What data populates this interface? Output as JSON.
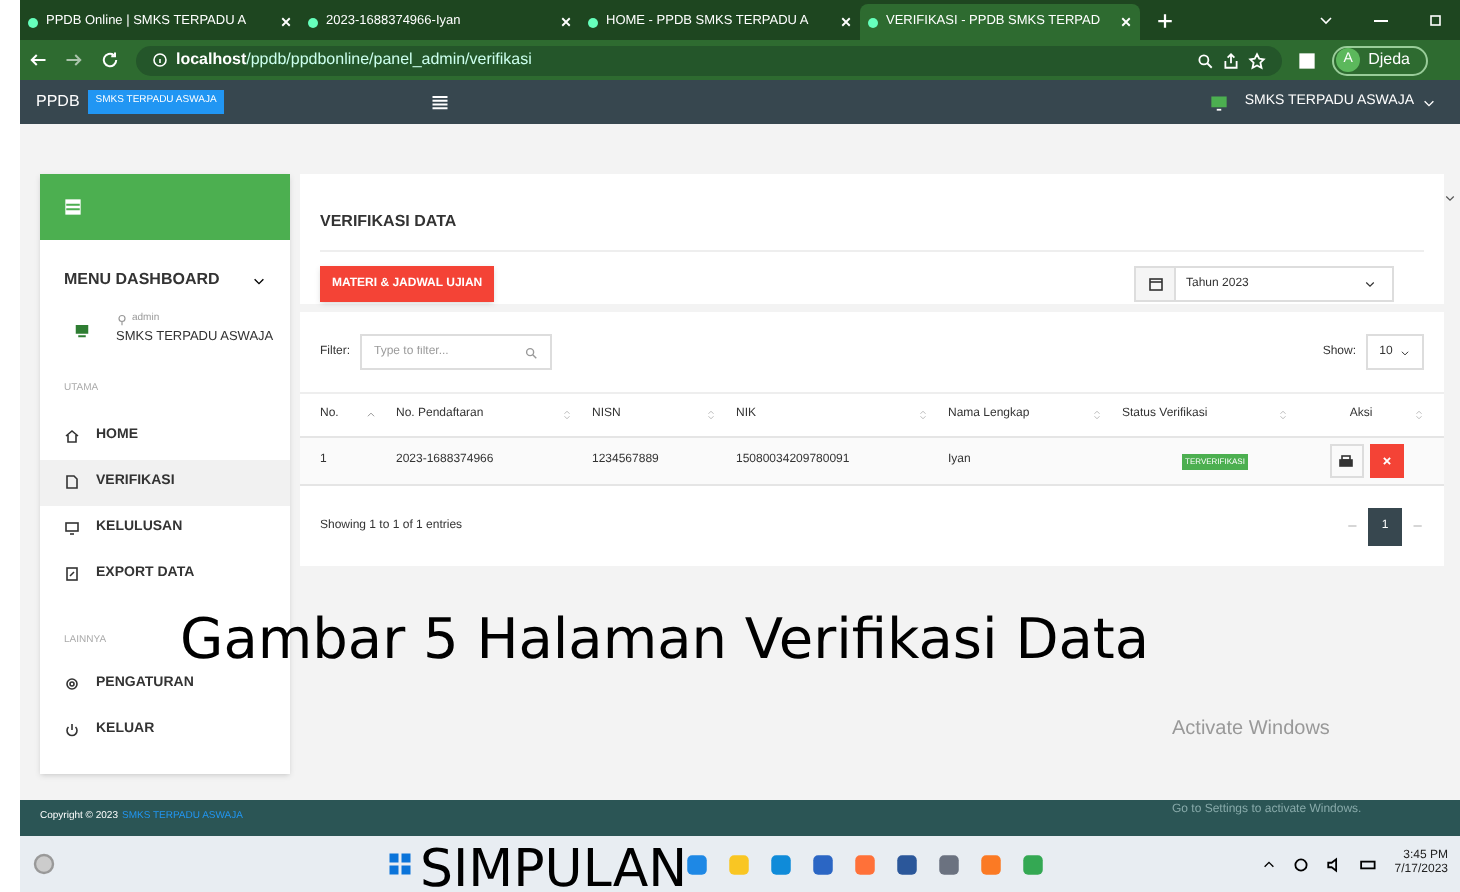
{
  "browser": {
    "tabs": [
      {
        "title": "PPDB Online | SMKS TERPADU A",
        "selected": false
      },
      {
        "title": "2023-1688374966-Iyan",
        "selected": false
      },
      {
        "title": "HOME - PPDB SMKS TERPADU A",
        "selected": false
      },
      {
        "title": "VERIFIKASI - PPDB SMKS TERPAD",
        "selected": true
      }
    ],
    "address": {
      "host": "localhost",
      "path": "/ppdb/ppdbonline/panel_admin/verifikasi"
    },
    "profile": {
      "initial": "A",
      "name": "Djeda"
    }
  },
  "navbar": {
    "brand": "PPDB",
    "badge": "SMKS TERPADU ASWAJA",
    "school": "SMKS TERPADU ASWAJA"
  },
  "sidebar": {
    "title": "MENU DASHBOARD",
    "user_role": "admin",
    "user_name": "SMKS TERPADU ASWAJA",
    "sections": [
      {
        "heading": "UTAMA",
        "items": [
          {
            "label": "HOME",
            "kind": "home",
            "selected": false
          },
          {
            "label": "VERIFIKASI",
            "kind": "doc",
            "selected": true
          },
          {
            "label": "KELULUSAN",
            "kind": "monitor",
            "selected": false
          },
          {
            "label": "EXPORT DATA",
            "kind": "file",
            "selected": false
          }
        ]
      },
      {
        "heading": "LAINNYA",
        "items": [
          {
            "label": "PENGATURAN",
            "kind": "gear",
            "selected": false
          },
          {
            "label": "KELUAR",
            "kind": "power",
            "selected": false
          }
        ]
      }
    ]
  },
  "main": {
    "title": "VERIFIKASI DATA",
    "button": "MATERI & JADWAL UJIAN",
    "year": "Tahun 2023",
    "filter_label": "Filter:",
    "filter_placeholder": "Type to filter...",
    "show_label": "Show:",
    "show_value": "10",
    "columns": [
      "No.",
      "No. Pendaftaran",
      "NISN",
      "NIK",
      "Nama Lengkap",
      "Status Verifikasi",
      "Aksi"
    ],
    "rows": [
      {
        "no": "1",
        "reg": "2023-1688374966",
        "nisn": "1234567889",
        "nik": "15080034209780091",
        "name": "Iyan",
        "status": "TERVERIFIKASI"
      }
    ],
    "info": "Showing 1 to 1 of 1 entries",
    "pages": [
      {
        "label": "1",
        "selected": true
      }
    ]
  },
  "footer": {
    "copyright": "Copyright © 2023",
    "link": "SMKS TERPADU ASWAJA"
  },
  "activation": {
    "title": "Activate Windows",
    "hint": "Go to Settings to activate Windows."
  },
  "taskbar": {
    "time": "3:45 PM",
    "date": "7/17/2023"
  },
  "captions": [
    {
      "text": "Gambar 5 Halaman Verifikasi Data",
      "kind": "figure"
    },
    {
      "text": "SIMPULAN",
      "kind": "heading"
    }
  ]
}
